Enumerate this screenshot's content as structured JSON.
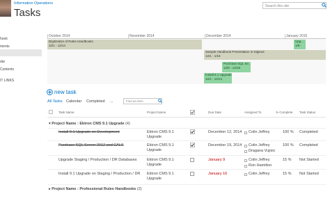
{
  "header": {
    "site_link": "Information Operations",
    "title": "Tasks",
    "search_placeholder": "Search this site"
  },
  "nav": {
    "items": [
      "hook",
      "ments",
      "",
      "dar",
      "Contents",
      "IT LINKS"
    ]
  },
  "timeline": {
    "months": [
      "October 2014",
      "November 2014",
      "December 2014",
      "January 2015"
    ],
    "bars": [
      {
        "title": "Digitization of Rules Handbooks",
        "dates": "10/1 - 12/14",
        "color": "gray"
      },
      {
        "title": "Upg...",
        "dates": "1/8 -",
        "color": "green"
      },
      {
        "title": "Sample Handbook Presentation in Digitool",
        "dates": "12/1 - 1/16",
        "color": "gray"
      },
      {
        "title": "Purchase SQL Se...",
        "dates": "12/5 - 12/19",
        "color": "green"
      },
      {
        "title": "Install 9.1 Upgrade on...",
        "dates": "12/1 - 12/14",
        "color": "green"
      }
    ]
  },
  "toolbar": {
    "new_task": "new task",
    "tabs": [
      "All Tasks",
      "Calendar",
      "Completed",
      "..."
    ],
    "find_placeholder": "Find an item"
  },
  "table": {
    "columns": [
      "Task Name",
      "Project Name",
      "",
      "Due Date",
      "Assigned To",
      "% Complete",
      "Task Status"
    ],
    "groups": [
      {
        "label": "Project Name : Ektron CMS 9.1 Upgrade",
        "count": "(4)",
        "rows": [
          {
            "task": "Install 9.1 Upgrade on Development",
            "project": "Ektron CMS 9.1 Upgrade",
            "checked": true,
            "due": "December 12, 2014",
            "assigned": [
              "Colin Jeffrey"
            ],
            "percent": "100 %",
            "status": "Completed",
            "done": true,
            "overdue": false
          },
          {
            "task": "Purchase SQL Server 2012 and CALS",
            "project": "Ektron CMS 9.1 Upgrade",
            "checked": true,
            "due": "December 19, 2014",
            "assigned": [
              "Colin Jeffrey",
              "Dragana Vujisic"
            ],
            "percent": "100 %",
            "status": "Completed",
            "done": true,
            "overdue": false
          },
          {
            "task": "Upgrade Staging / Production / DR Databases",
            "project": "Ektron CMS 9.1 Upgrade",
            "checked": false,
            "due": "January 9",
            "assigned": [
              "Colin Jeffrey",
              "Ron Hamilton"
            ],
            "percent": "15 %",
            "status": "Not Started",
            "done": false,
            "overdue": true
          },
          {
            "task": "Install 9.1 Upgrade on Staging / Production / DR",
            "project": "Ektron CMS 9.1 Upgrade",
            "checked": false,
            "due": "January 16",
            "assigned": [
              "Colin Jeffrey"
            ],
            "percent": "15 %",
            "status": "Not Started",
            "done": false,
            "overdue": true
          }
        ]
      },
      {
        "label": "Project Name : Professional Rules Handbooks",
        "count": "(2)",
        "rows": []
      }
    ]
  },
  "colors": {
    "accent": "#0072c6",
    "overdue": "#c00000",
    "timeline_gray": "#d2d3bf",
    "timeline_green": "#8fd4a1"
  }
}
